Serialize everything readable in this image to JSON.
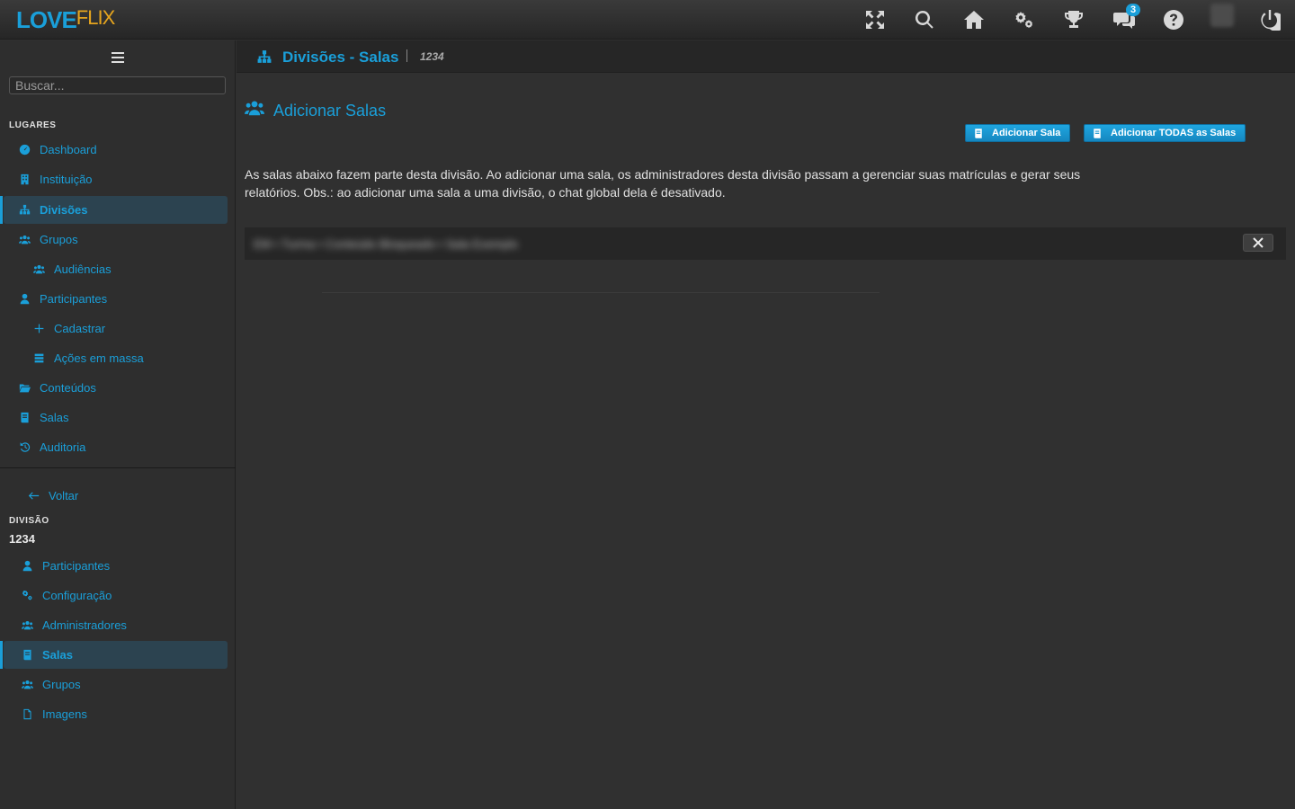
{
  "brand": {
    "love": "LOVE",
    "flix": "FLIX"
  },
  "topbar": {
    "icons": [
      "fullscreen-icon",
      "search-icon",
      "home-icon",
      "settings-icon",
      "trophy-icon",
      "chat-icon",
      "help-icon",
      "avatar",
      "power-icon"
    ],
    "chat_badge": "3"
  },
  "sidebar": {
    "search_placeholder": "Buscar...",
    "places_label": "LUGARES",
    "places": [
      {
        "label": "Dashboard",
        "icon": "dashboard-icon"
      },
      {
        "label": "Instituição",
        "icon": "building-icon"
      },
      {
        "label": "Divisões",
        "icon": "sitemap-icon",
        "active": true
      },
      {
        "label": "Grupos",
        "icon": "users-icon"
      },
      {
        "label": "Audiências",
        "icon": "users-icon"
      },
      {
        "label": "Participantes",
        "icon": "user-icon"
      },
      {
        "label": "Cadastrar",
        "icon": "plus-icon"
      },
      {
        "label": "Ações em massa",
        "icon": "list-icon"
      },
      {
        "label": "Conteúdos",
        "icon": "folder-icon"
      },
      {
        "label": "Salas",
        "icon": "book-icon"
      },
      {
        "label": "Auditoria",
        "icon": "history-icon"
      }
    ],
    "back_label": "Voltar",
    "division_label": "DIVISÃO",
    "division_name": "1234",
    "division_items": [
      {
        "label": "Participantes",
        "icon": "user-icon"
      },
      {
        "label": "Configuração",
        "icon": "cogs-icon"
      },
      {
        "label": "Administradores",
        "icon": "users-icon"
      },
      {
        "label": "Salas",
        "icon": "book-icon",
        "active": true
      },
      {
        "label": "Grupos",
        "icon": "users-icon"
      },
      {
        "label": "Imagens",
        "icon": "file-icon"
      }
    ]
  },
  "header": {
    "title": "Divisões - Salas",
    "subtitle": "1234"
  },
  "main": {
    "section_title": "Adicionar Salas",
    "add_room_button": "Adicionar Sala",
    "add_all_button": "Adicionar TODAS as Salas",
    "description": "As salas abaixo fazem parte desta divisão. Ao adicionar uma sala, os administradores desta divisão passam a gerenciar suas matrículas e gerar seus relatórios. Obs.: ao adicionar uma sala a uma divisão, o chat global dela é desativado.",
    "rooms": [
      {
        "name": "EM • Turma • Conteúdo Bloqueado • Sala Exemplo"
      }
    ]
  },
  "colors": {
    "accent": "#1a9fd9",
    "brand_secondary": "#e6a51e",
    "background": "#303030"
  }
}
